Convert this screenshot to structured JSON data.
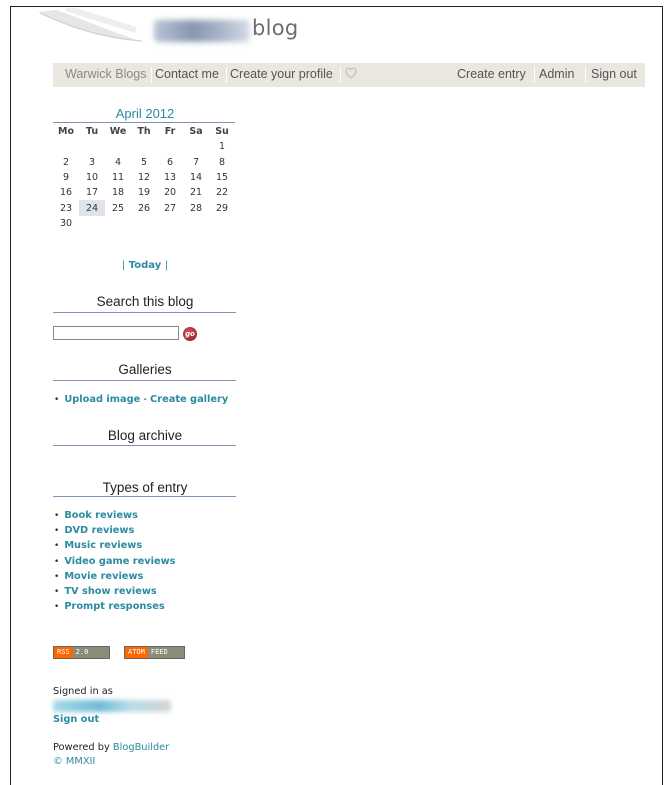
{
  "header": {
    "blog_word": "blog"
  },
  "nav": {
    "warwick_blogs": "Warwick Blogs",
    "contact_me": "Contact me",
    "create_profile": "Create your profile",
    "create_entry": "Create entry",
    "admin": "Admin",
    "sign_out": "Sign out"
  },
  "calendar": {
    "title": "April 2012",
    "days": [
      "Mo",
      "Tu",
      "We",
      "Th",
      "Fr",
      "Sa",
      "Su"
    ],
    "weeks": [
      [
        "",
        "",
        "",
        "",
        "",
        "",
        "1"
      ],
      [
        "2",
        "3",
        "4",
        "5",
        "6",
        "7",
        "8"
      ],
      [
        "9",
        "10",
        "11",
        "12",
        "13",
        "14",
        "15"
      ],
      [
        "16",
        "17",
        "18",
        "19",
        "20",
        "21",
        "22"
      ],
      [
        "23",
        "24",
        "25",
        "26",
        "27",
        "28",
        "29"
      ],
      [
        "30",
        "",
        "",
        "",
        "",
        "",
        ""
      ]
    ],
    "highlighted_day": "24",
    "today_label": "Today",
    "separator": "|"
  },
  "search": {
    "title": "Search this blog",
    "input_value": "",
    "go_label": "go"
  },
  "galleries": {
    "title": "Galleries",
    "upload": "Upload image",
    "dash": "-",
    "create": "Create gallery"
  },
  "archive": {
    "title": "Blog archive"
  },
  "types": {
    "title": "Types of entry",
    "items": [
      "Book reviews",
      "DVD reviews",
      "Music reviews",
      "Video game reviews",
      "Movie reviews",
      "TV show reviews",
      "Prompt responses"
    ]
  },
  "feeds": {
    "rss_left": "RSS",
    "rss_right": "2.0",
    "atom_left": "ATOM",
    "atom_right": "FEED"
  },
  "footer": {
    "signed_in_as": "Signed in as",
    "sign_out": "Sign out",
    "powered_by": "Powered by",
    "blogbuilder": "BlogBuilder",
    "copyright": "© MMXII"
  },
  "colors": {
    "link": "#2a8ba1",
    "nav_bg": "#e9e7e0",
    "rule": "#7f93b5",
    "rss_orange": "#ff6600"
  }
}
